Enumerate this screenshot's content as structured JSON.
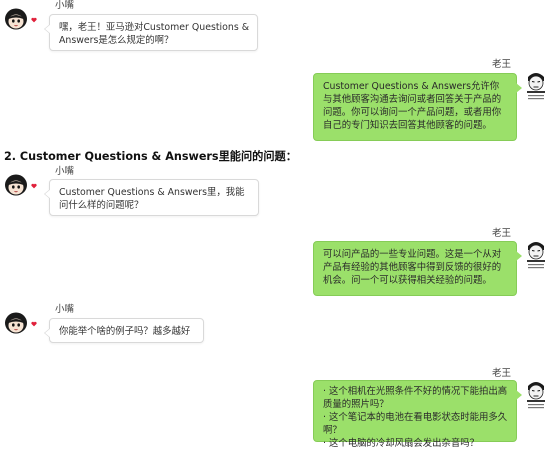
{
  "heading": "2. Customer Questions & Answers里能问的问题：",
  "messages": [
    {
      "speaker": "小嘴",
      "text": "嘿，老王！亚马逊对Customer Questions & Answers是怎么规定的啊？"
    },
    {
      "speaker": "老王",
      "text": "Customer Questions & Answers允许你与其他顾客沟通去询问或者回答关于产品的问题。你可以询问一个产品问题，或者用你自己的专门知识去回答其他顾客的问题。"
    },
    {
      "speaker": "小嘴",
      "text": "Customer Questions & Answers里，我能问什么样的问题呢？"
    },
    {
      "speaker": "老王",
      "text": "可以问产品的一些专业问题。这是一个从对产品有经验的其他顾客中得到反馈的很好的机会。问一个可以获得相关经验的问题。"
    },
    {
      "speaker": "小嘴",
      "text": "你能举个啥的例子吗？越多越好"
    },
    {
      "speaker": "老王",
      "lines": [
        "· 这个相机在光照条件不好的情况下能拍出高质量的照片吗？",
        "· 这个笔记本的电池在看电影状态时能用多久啊？",
        "· 这个电脑的冷却风扇会发出杂音吗？"
      ]
    }
  ],
  "icons": {
    "left_avatar": "cartoon-girl-avatar-icon",
    "right_avatar": "cartoon-man-avatar-icon",
    "heart": "heart-icon"
  },
  "colors": {
    "right_bubble": "#9be06a",
    "left_bubble": "#ffffff",
    "heart": "#e0203a"
  }
}
